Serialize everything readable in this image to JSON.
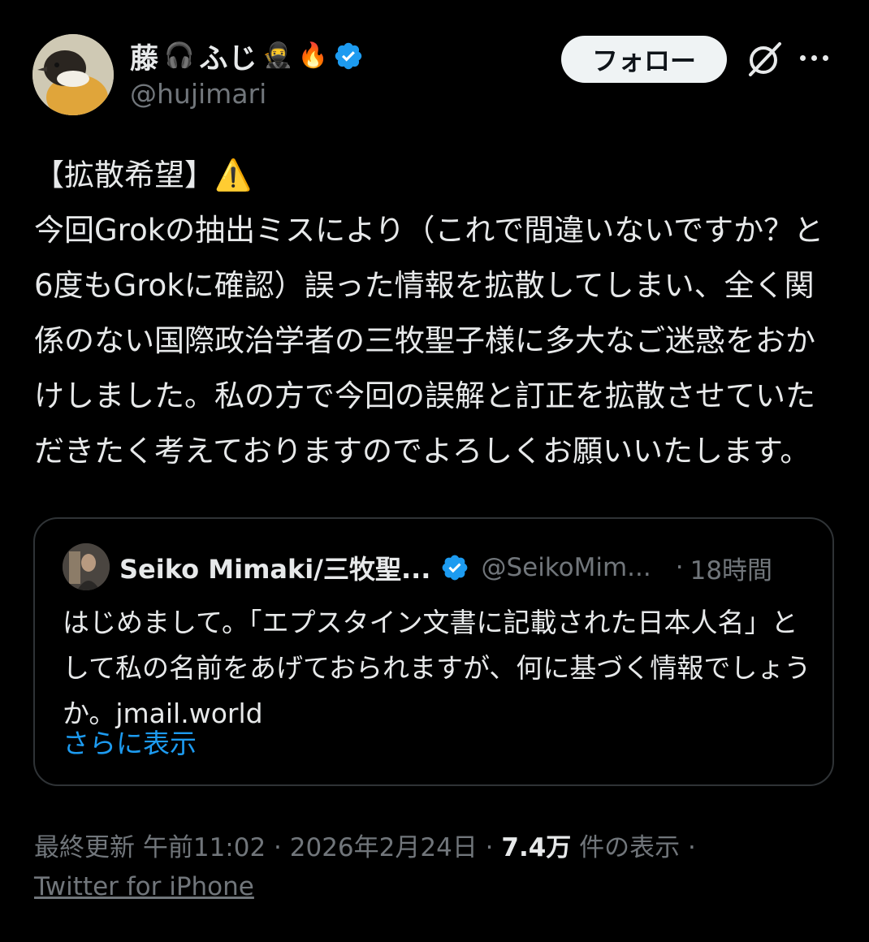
{
  "author": {
    "name_prefix": "藤",
    "name_mid": "ふじ",
    "emoji_headphones": "🎧",
    "emoji_ninja": "🥷",
    "emoji_fire": "🔥",
    "handle": "@hujimari",
    "verified_icon": "verified-badge-icon"
  },
  "header": {
    "follow_label": "フォロー",
    "grok_icon": "grok-icon",
    "more_icon": "more-icon"
  },
  "tweet": {
    "text": "【拡散希望】⚠️\n今回Grokの抽出ミスにより（これで間違いないですか？と6度もGrokに確認）誤った情報を拡散してしまい、全く関係のない国際政治学者の三牧聖子様に多大なご迷惑をおかけしました。私の方で今回の誤解と訂正を拡散させていただきたく考えておりますのでよろしくお願いいたします。"
  },
  "quote": {
    "name": "Seiko Mimaki/三牧聖...",
    "handle": "@SeikoMim...",
    "time": "18時間",
    "separator": "·",
    "text": "はじめまして。「エプスタイン文書に記載された日本人名」として私の名前をあげておられますが、何に基づく情報でしょうか。jmail.world",
    "show_more": "さらに表示"
  },
  "footer": {
    "updated_label": "最終更新 午前11:02 · 2026年2月24日 · ",
    "views": "7.4万",
    "views_suffix": " 件の表示 ·",
    "source": "Twitter for iPhone"
  },
  "colors": {
    "background": "#000000",
    "text": "#e7e9ea",
    "secondary": "#71767b",
    "link": "#1d9bf0",
    "verified": "#1d9bf0"
  }
}
